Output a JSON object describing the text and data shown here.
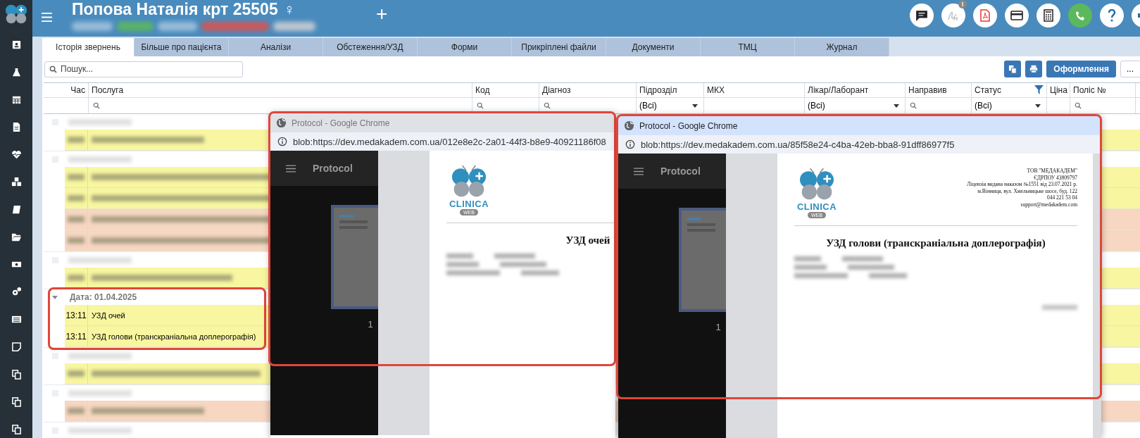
{
  "header": {
    "title": "Попова Наталія крт 25505",
    "gender_symbol": "♀",
    "add_symbol": "+",
    "notice_badge": "!"
  },
  "tabs": [
    {
      "label": "Історія звернень",
      "selected": true
    },
    {
      "label": "Більше про пацієнта",
      "selected": false
    },
    {
      "label": "Аналізи",
      "selected": false
    },
    {
      "label": "Обстеження/УЗД",
      "selected": false
    },
    {
      "label": "Форми",
      "selected": false
    },
    {
      "label": "Прикріплені файли",
      "selected": false
    },
    {
      "label": "Документи",
      "selected": false
    },
    {
      "label": "ТМЦ",
      "selected": false
    },
    {
      "label": "Журнал",
      "selected": false
    }
  ],
  "toolbar": {
    "search_placeholder": "Пошук...",
    "format_button": "Оформлення",
    "extra_field_value": "..."
  },
  "table": {
    "columns": [
      {
        "label": "Час",
        "kind": "plain",
        "filtered": false
      },
      {
        "label": "Послуга",
        "kind": "search",
        "filtered": false
      },
      {
        "label": "Код",
        "kind": "search",
        "filtered": false
      },
      {
        "label": "Діагноз",
        "kind": "search",
        "filtered": false
      },
      {
        "label": "Підрозділ",
        "kind": "select",
        "filter_value": "(Всі)",
        "filtered": false
      },
      {
        "label": "МКХ",
        "kind": "plain",
        "filtered": false
      },
      {
        "label": "Лікар/Лаборант",
        "kind": "select",
        "filter_value": "(Всі)",
        "filtered": false
      },
      {
        "label": "Направив",
        "kind": "search",
        "filtered": false
      },
      {
        "label": "Статус",
        "kind": "select",
        "filter_value": "(Всі)",
        "filtered": true
      },
      {
        "label": "Ціна",
        "kind": "plain",
        "filtered": false
      },
      {
        "label": "Поліс №",
        "kind": "search",
        "filtered": false
      }
    ],
    "groups": [
      {
        "blurred": true,
        "highlight": false,
        "rows": [
          {
            "color": "#f8f6a0"
          }
        ]
      },
      {
        "blurred": true,
        "highlight": false,
        "rows": [
          {
            "color": "#f8f6a0"
          },
          {
            "color": "#f8f6a0"
          },
          {
            "color": "#f7d6c2"
          },
          {
            "color": "#f7d6c2"
          }
        ]
      },
      {
        "blurred": true,
        "highlight": false,
        "rows": [
          {
            "color": "#f8f6a0"
          }
        ]
      },
      {
        "blurred": false,
        "highlight": true,
        "label": "Дата: 01.04.2025",
        "rows": [
          {
            "time": "13:11",
            "service": "УЗД очей",
            "color": "#f8f6a0"
          },
          {
            "time": "13:11",
            "service": "УЗД голови (транскраніальна доплерографія)",
            "color": "#f8f6a0"
          }
        ]
      },
      {
        "blurred": true,
        "highlight": false,
        "rows": [
          {
            "color": "#f8f6a0"
          }
        ]
      },
      {
        "blurred": true,
        "highlight": false,
        "rows": [
          {
            "color": "#f7d6c2"
          }
        ]
      },
      {
        "blurred": true,
        "highlight": false
      }
    ]
  },
  "windows": [
    {
      "title": "Protocol - Google Chrome",
      "active": false,
      "highlight": true,
      "url": "blob:https://dev.medakadem.com.ua/012e8e2c-2a01-44f3-b8e9-40921186f08",
      "viewer_title": "Protocol",
      "page_number": "1",
      "document": {
        "logo_name": "CLINICA",
        "logo_tag": "WEB",
        "title": "УЗД очей"
      }
    },
    {
      "title": "Protocol - Google Chrome",
      "active": true,
      "highlight": true,
      "url": "blob:https://dev.medakadem.com.ua/85f58e24-c4ba-42eb-bba8-91dff86977f5",
      "viewer_title": "Protocol",
      "page_number": "1",
      "document": {
        "logo_name": "CLINICA",
        "logo_tag": "WEB",
        "title": "УЗД голови (транскраніальна доплерографія)",
        "header_lines": [
          "ТОВ \"МЕДАКАДЕМ\"",
          "ЄДРПОУ 43809797",
          "Ліцензія видана наказом №1551 від 23.07.2021 р.",
          "м.Вінниця, вул. Хмельницьке шосе, буд. 122",
          "044 221 53 04",
          "support@medakadem.com"
        ]
      }
    }
  ]
}
